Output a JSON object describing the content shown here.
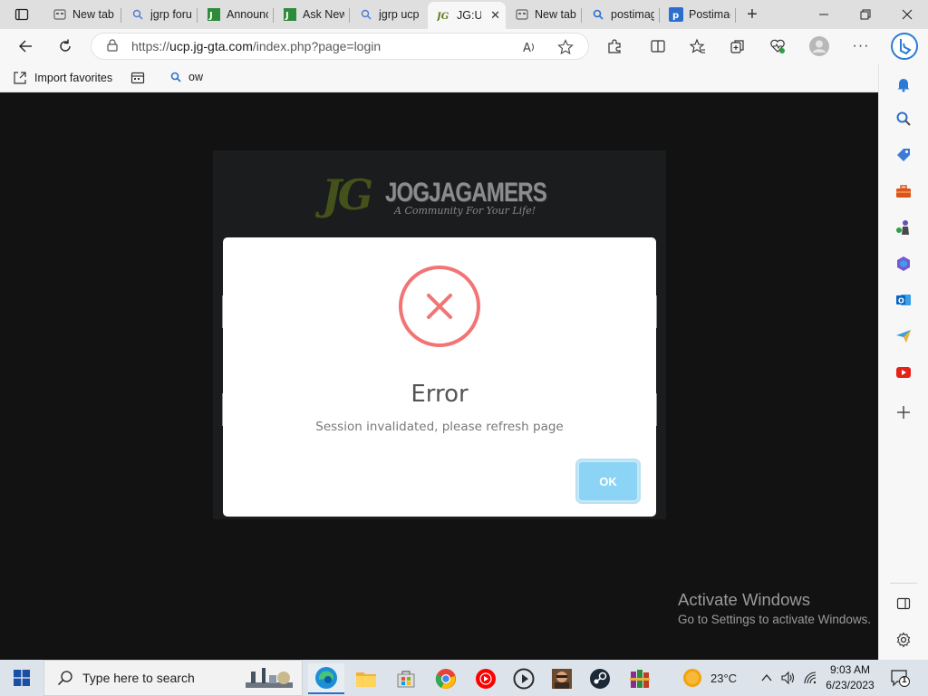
{
  "tabs": [
    {
      "title": "New tab",
      "icon": "newtab-icon"
    },
    {
      "title": "jgrp forum",
      "icon": "search-icon"
    },
    {
      "title": "Announce",
      "icon": "jg-site-icon"
    },
    {
      "title": "Ask New",
      "icon": "jg-site-icon"
    },
    {
      "title": "jgrp ucp",
      "icon": "search-icon"
    },
    {
      "title": "JG:U",
      "icon": "jg-logo-icon",
      "active": true
    },
    {
      "title": "New tab",
      "icon": "newtab-icon"
    },
    {
      "title": "postimage",
      "icon": "search-icon"
    },
    {
      "title": "Postimage",
      "icon": "postimage-icon"
    }
  ],
  "address": {
    "url_prefix": "https://",
    "url_host": "ucp.jg-gta.com",
    "url_path": "/index.php?page=login"
  },
  "favorites": {
    "import_label": "Import favorites",
    "item_label": "ow"
  },
  "logo": {
    "mark": "JG",
    "brand": "JOGJAGAMERS",
    "tagline": "A Community For Your Life!"
  },
  "dialog": {
    "title": "Error",
    "message": "Session invalidated, please refresh page",
    "ok_label": "OK"
  },
  "watermark": {
    "line1": "Activate Windows",
    "line2": "Go to Settings to activate Windows."
  },
  "taskbar": {
    "search_placeholder": "Type here to search",
    "temperature": "23°C",
    "time": "9:03 AM",
    "date": "6/23/2023",
    "notification_count": "1"
  },
  "colors": {
    "error_red": "#f27474",
    "ok_button": "#8cd4f5",
    "page_bg": "#1c1c1c"
  }
}
